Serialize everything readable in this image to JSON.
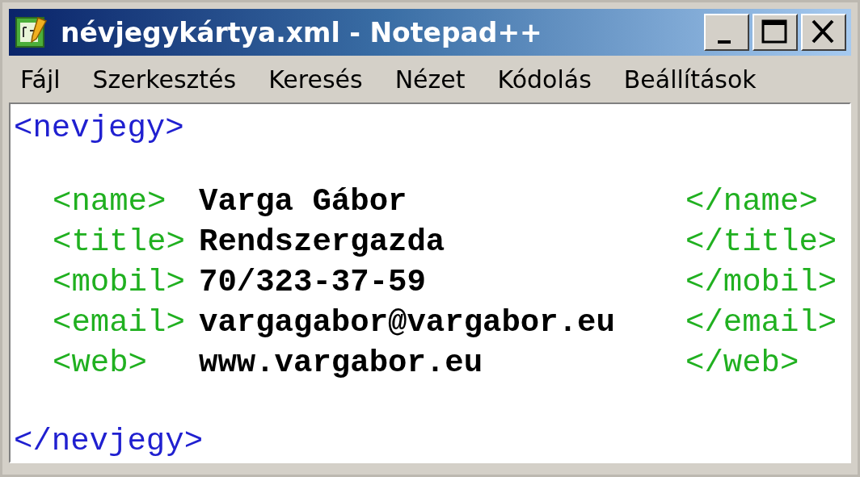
{
  "window": {
    "title": "névjegykártya.xml - Notepad++"
  },
  "menu": [
    "Fájl",
    "Szerkesztés",
    "Keresés",
    "Nézet",
    "Kódolás",
    "Beállítások"
  ],
  "editor": {
    "open_tag": "<nevjegy>",
    "close_tag": "</nevjegy>",
    "fields": [
      {
        "open": "<name>",
        "value": "Varga Gábor",
        "close": "</name>"
      },
      {
        "open": "<title>",
        "value": "Rendszergazda",
        "close": "</title>"
      },
      {
        "open": "<mobil>",
        "value": "70/323-37-59",
        "close": "</mobil>"
      },
      {
        "open": "<email>",
        "value": "vargagabor@vargabor.eu",
        "close": "</email>"
      },
      {
        "open": "<web>",
        "value": "www.vargabor.eu",
        "close": "</web>"
      }
    ]
  }
}
